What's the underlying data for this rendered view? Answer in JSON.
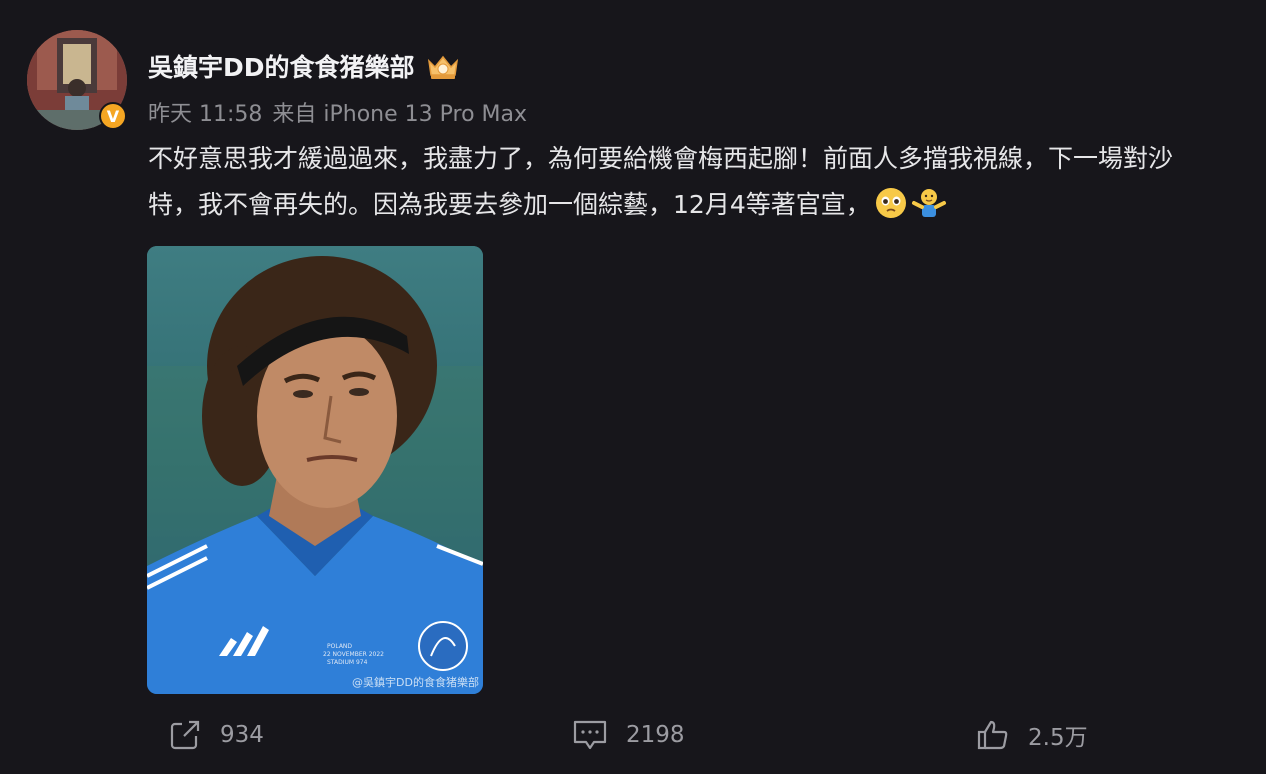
{
  "post": {
    "author": {
      "name": "吳鎮宇DD的食食猪樂部",
      "verified_badge": "V",
      "avatar": "user-avatar",
      "member_badge": "crown-badge-icon"
    },
    "meta": {
      "time": "昨天 11:58",
      "source": "来自 iPhone 13 Pro Max"
    },
    "text": "不好意思我才緩過過來，我盡力了，為何要給機會梅西起腳！前面人多擋我視線，下一場對沙特，我不會再失的。因為我要去參加一個綜藝，12月4等著官宣，",
    "emojis": [
      "pleading-face-emoji",
      "shrug-emoji"
    ],
    "image": {
      "description": "photo-goalkeeper",
      "watermark": "@吳鎮宇DD的食食猪樂部"
    },
    "actions": {
      "share": {
        "icon": "share-icon",
        "count": "934"
      },
      "comment": {
        "icon": "comment-icon",
        "count": "2198"
      },
      "like": {
        "icon": "thumbs-up-icon",
        "count": "2.5万"
      }
    }
  },
  "colors": {
    "background": "#17161b",
    "text": "#e6e6e8",
    "muted": "#8e8e93",
    "verified": "#f5a623"
  }
}
